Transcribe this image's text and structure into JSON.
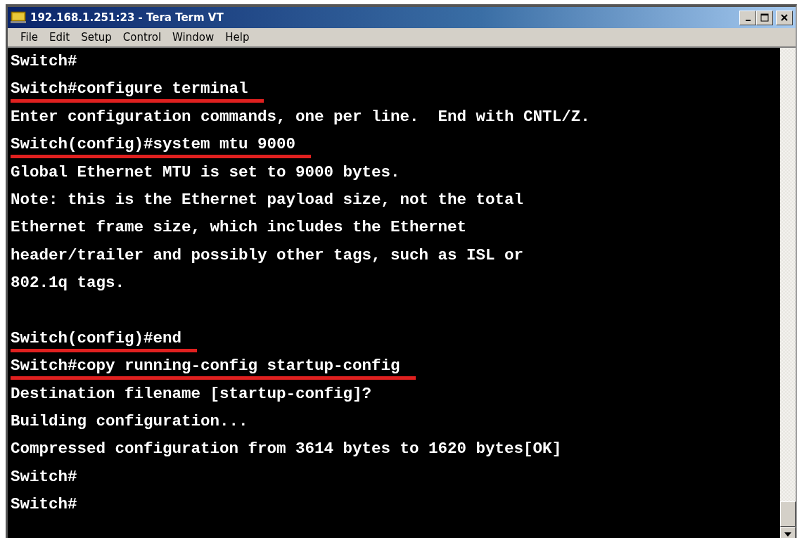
{
  "window": {
    "title": "192.168.1.251:23 - Tera Term VT"
  },
  "menu": [
    "File",
    "Edit",
    "Setup",
    "Control",
    "Window",
    "Help"
  ],
  "terminal": {
    "lines": [
      {
        "kind": "line",
        "text": "Switch#",
        "underlined": false
      },
      {
        "kind": "line",
        "text": "Switch#configure terminal",
        "underlined": true
      },
      {
        "kind": "line",
        "text": "Enter configuration commands, one per line.  End with CNTL/Z.",
        "underlined": false
      },
      {
        "kind": "line",
        "text": "Switch(config)#system mtu 9000",
        "underlined": true
      },
      {
        "kind": "line",
        "text": "Global Ethernet MTU is set to 9000 bytes.",
        "underlined": false
      },
      {
        "kind": "line",
        "text": "Note: this is the Ethernet payload size, not the total",
        "underlined": false
      },
      {
        "kind": "line",
        "text": "Ethernet frame size, which includes the Ethernet",
        "underlined": false
      },
      {
        "kind": "line",
        "text": "header/trailer and possibly other tags, such as ISL or",
        "underlined": false
      },
      {
        "kind": "line",
        "text": "802.1q tags.",
        "underlined": false
      },
      {
        "kind": "blank"
      },
      {
        "kind": "line",
        "text": "Switch(config)#end",
        "underlined": true
      },
      {
        "kind": "line",
        "text": "Switch#copy running-config startup-config",
        "underlined": true
      },
      {
        "kind": "line",
        "text": "Destination filename [startup-config]?",
        "underlined": false
      },
      {
        "kind": "line",
        "text": "Building configuration...",
        "underlined": false
      },
      {
        "kind": "line",
        "text": "Compressed configuration from 3614 bytes to 1620 bytes[OK]",
        "underlined": false
      },
      {
        "kind": "line",
        "text": "Switch#",
        "underlined": false
      },
      {
        "kind": "line",
        "text": "Switch#",
        "underlined": false
      }
    ]
  }
}
